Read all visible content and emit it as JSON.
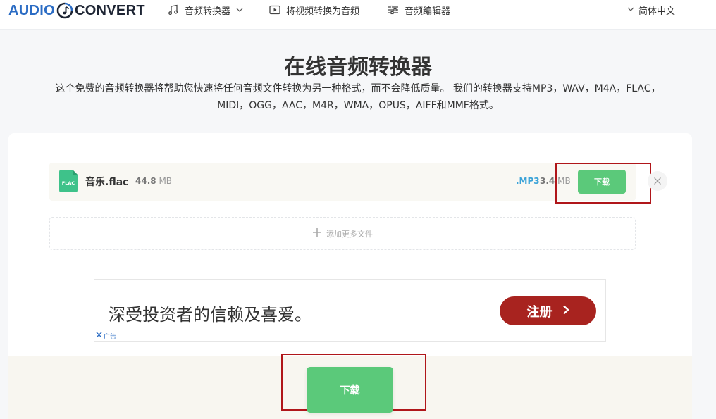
{
  "header": {
    "logo_word1": "AUDIO",
    "logo_word2": "CONVERT",
    "nav": [
      {
        "label": "音频转换器",
        "icon": "music-note-icon",
        "has_dropdown": true
      },
      {
        "label": "将视频转换为音频",
        "icon": "play-video-icon",
        "has_dropdown": false
      },
      {
        "label": "音频编辑器",
        "icon": "sliders-icon",
        "has_dropdown": false
      }
    ],
    "language": "简体中文"
  },
  "hero": {
    "title": "在线音频转换器",
    "description_line1": "这个免费的音频转换器将帮助您快速将任何音频文件转换为另一种格式，而不会降低质量。 我们的转换器支持MP3，WAV，M4A，FLAC，",
    "description_line2": "MIDI，OGG，AAC，M4R，WMA，OPUS，AIFF和MMF格式。"
  },
  "file": {
    "icon_label": "FLAC",
    "name": "音乐.flac",
    "size_value": "44.8",
    "size_unit": "MB",
    "output_format": ".MP3",
    "output_size_value": "3.4",
    "output_size_unit": "MB",
    "download_label": "下载"
  },
  "add_more_label": "添加更多文件",
  "ad": {
    "text": "深受投资者的信赖及喜爱。",
    "button_label": "注册",
    "mark_label": "广告"
  },
  "download_all_label": "下载",
  "colors": {
    "brand_blue": "#2b6cc4",
    "download_green": "#5bc97a",
    "format_blue": "#3ba3d8",
    "ad_button_red": "#a8231f",
    "highlight_red": "#b0161a"
  }
}
